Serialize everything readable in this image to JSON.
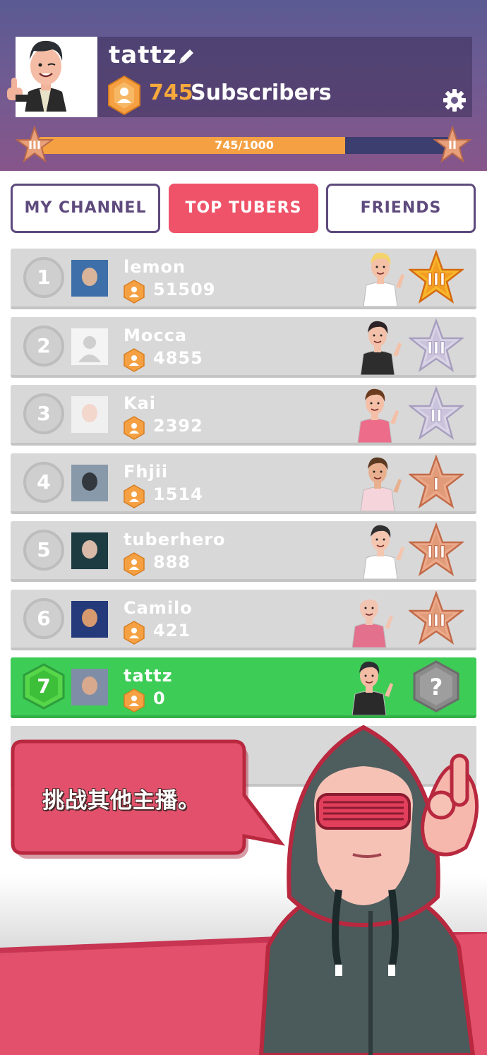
{
  "profile": {
    "username": "tattz",
    "subscriber_count": "745",
    "subscriber_label": "Subscribers",
    "progress_text": "745/1000",
    "progress_fraction": 0.745,
    "level_current": "III",
    "level_next": "II"
  },
  "tabs": [
    {
      "label": "MY CHANNEL",
      "active": false
    },
    {
      "label": "TOP TUBERS",
      "active": true
    },
    {
      "label": "FRIENDS",
      "active": false
    }
  ],
  "leaderboard": [
    {
      "rank": "1",
      "name": "lemon",
      "subs": "51509",
      "badge": "gold",
      "badge_level": "III"
    },
    {
      "rank": "2",
      "name": "Mocca",
      "subs": "4855",
      "badge": "silver",
      "badge_level": "III"
    },
    {
      "rank": "3",
      "name": "Kai",
      "subs": "2392",
      "badge": "silver",
      "badge_level": "II"
    },
    {
      "rank": "4",
      "name": "Fhjii",
      "subs": "1514",
      "badge": "bronze",
      "badge_level": "I"
    },
    {
      "rank": "5",
      "name": "tuberhero",
      "subs": "888",
      "badge": "bronze",
      "badge_level": "III"
    },
    {
      "rank": "6",
      "name": "Camilo",
      "subs": "421",
      "badge": "bronze",
      "badge_level": "III"
    },
    {
      "rank": "7",
      "name": "tattz",
      "subs": "0",
      "badge": "unknown",
      "badge_level": "?"
    }
  ],
  "tutorial": {
    "message": "挑战其他主播。"
  },
  "colors": {
    "accent_red": "#ee5369",
    "accent_green": "#3dcc56",
    "accent_orange": "#f5a143",
    "tab_border": "#5e4a7d"
  }
}
